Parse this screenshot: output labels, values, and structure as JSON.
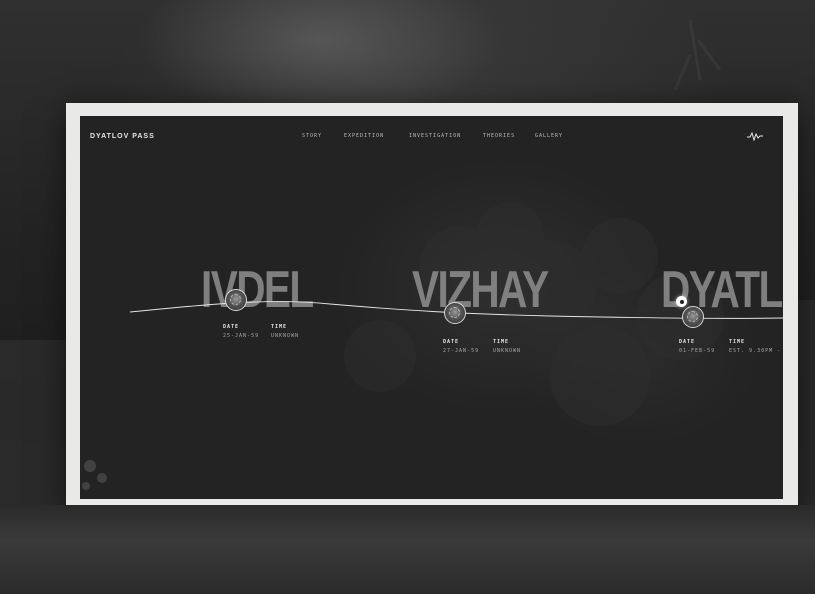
{
  "site": {
    "brand": "DYATLOV PASS"
  },
  "nav": {
    "items": [
      {
        "label": "STORY"
      },
      {
        "label": "EXPEDITION"
      },
      {
        "label": "INVESTIGATION"
      },
      {
        "label": "THEORIES"
      },
      {
        "label": "GALLERY"
      }
    ],
    "audio_icon": "waveform-icon"
  },
  "timeline": {
    "stops": [
      {
        "name": "IVDEL",
        "date_label": "DATE",
        "date_value": "25-JAN-59",
        "time_label": "TIME",
        "time_value": "UNKNOWN"
      },
      {
        "name": "VIZHAY",
        "date_label": "DATE",
        "date_value": "27-JAN-59",
        "time_label": "TIME",
        "time_value": "UNKNOWN"
      },
      {
        "name": "DYATL",
        "date_label": "DATE",
        "date_value": "01-FEB-59",
        "time_label": "TIME",
        "time_value": "EST. 9.30PM -"
      }
    ],
    "current_marker_icon": "location-marker-icon"
  },
  "colors": {
    "frame": "#e9e9e7",
    "screen": "#232323",
    "text": "#e6e6e6",
    "stop_name": "#8c8c8c"
  }
}
